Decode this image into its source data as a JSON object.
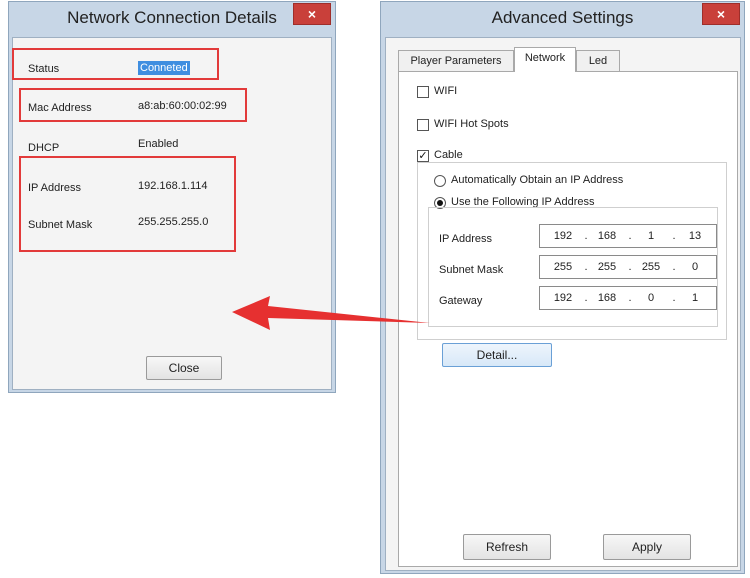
{
  "left_dialog": {
    "title": "Network Connection Details",
    "close_glyph": "×",
    "rows": [
      {
        "label": "Status",
        "value": "Conneted"
      },
      {
        "label": "Mac Address",
        "value": "a8:ab:60:00:02:99"
      },
      {
        "label": "DHCP",
        "value": "Enabled"
      },
      {
        "label": "IP Address",
        "value": "192.168.1.114"
      },
      {
        "label": "Subnet Mask",
        "value": "255.255.255.0"
      }
    ],
    "close_button": "Close"
  },
  "right_dialog": {
    "title": "Advanced Settings",
    "close_glyph": "×",
    "tabs": [
      {
        "label": "Player Parameters",
        "active": false
      },
      {
        "label": "Network",
        "active": true
      },
      {
        "label": "Led",
        "active": false
      }
    ],
    "wifi": {
      "label": "WIFI",
      "checked": false
    },
    "hotspots": {
      "label": "WIFI Hot Spots",
      "checked": false
    },
    "cable": {
      "label": "Cable",
      "checked": true
    },
    "auto_ip": {
      "label": "Automatically Obtain an IP Address",
      "selected": false
    },
    "manual_ip": {
      "label": "Use the Following IP Address",
      "selected": true
    },
    "fields": [
      {
        "label": "IP Address",
        "octets": [
          "192",
          "168",
          "1",
          "13"
        ]
      },
      {
        "label": "Subnet Mask",
        "octets": [
          "255",
          "255",
          "255",
          "0"
        ]
      },
      {
        "label": "Gateway",
        "octets": [
          "192",
          "168",
          "0",
          "1"
        ]
      }
    ],
    "detail_button": "Detail...",
    "refresh_button": "Refresh",
    "apply_button": "Apply",
    "check_glyph": "✓"
  },
  "colors": {
    "highlight_red": "#e23a3a",
    "arrow_red": "#e63030",
    "selection_blue": "#3f8ee0"
  },
  "icons": {
    "close": "close-icon",
    "arrow": "arrow-left-annotation"
  }
}
